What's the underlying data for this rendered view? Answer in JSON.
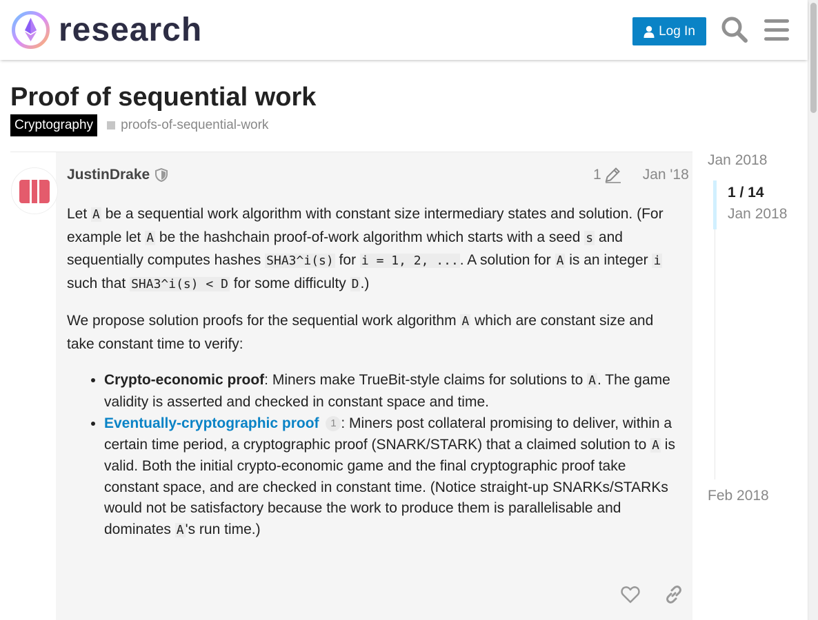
{
  "header": {
    "logo_text": "research",
    "login_label": "Log In"
  },
  "topic": {
    "title": "Proof of sequential work",
    "category": "Cryptography",
    "tag": "proofs-of-sequential-work"
  },
  "post": {
    "username": "JustinDrake",
    "edit_count": "1",
    "date": "Jan '18",
    "p1": {
      "t1": "Let ",
      "c1": "A",
      "t2": " be a sequential work algorithm with constant size intermediary states and solution. (For example let ",
      "c2": "A",
      "t3": " be the hashchain proof-of-work algorithm which starts with a seed ",
      "c3": "s",
      "t4": " and sequentially computes hashes ",
      "c4": "SHA3^i(s)",
      "t5": " for ",
      "c5": "i = 1, 2, ...",
      "t6": ". A solution for ",
      "c6": "A",
      "t7": " is an integer ",
      "c7": "i",
      "t8": " such that ",
      "c8": "SHA3^i(s) < D",
      "t9": " for some difficulty ",
      "c9": "D",
      "t10": ".)"
    },
    "p2": {
      "t1": "We propose solution proofs for the sequential work algorithm ",
      "c1": "A",
      "t2": " which are constant size and take constant time to verify:"
    },
    "li1": {
      "strong": "Crypto-economic proof",
      "t1": ": Miners make TrueBit-style claims for solutions to ",
      "c1": "A",
      "t2": ". The game validity is asserted and checked in constant space and time."
    },
    "li2": {
      "link": "Eventually-cryptographic proof",
      "footnote": "1",
      "t1": ": Miners post collateral promising to deliver, within a certain time period, a cryptographic proof (SNARK/STARK) that a claimed solution to ",
      "c1": "A",
      "t2": " is valid. Both the initial crypto-economic game and the final cryptographic proof take constant space, and are checked in constant time. (Notice straight-up SNARKs/STARKs would not be satisfactory because the work to produce them is parallelisable and dominates ",
      "c2": "A",
      "t3": "'s run time.)"
    }
  },
  "timeline": {
    "start": "Jan 2018",
    "count": "1 / 14",
    "current_date": "Jan 2018",
    "end": "Feb 2018"
  },
  "colors": {
    "accent": "#0a83c6",
    "category_bg": "#000000",
    "avatar": "#e45b6c"
  }
}
